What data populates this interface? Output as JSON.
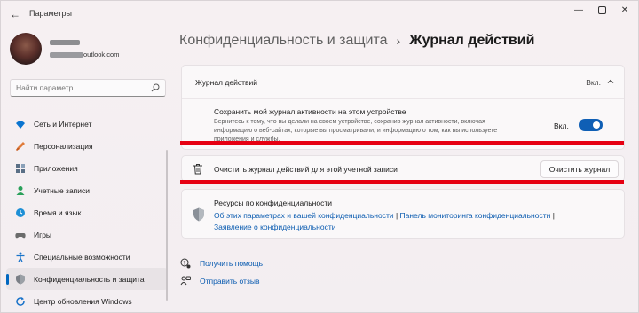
{
  "window": {
    "app_title": "Параметры",
    "back_icon": "back-arrow-icon",
    "minimize_icon": "minimize-icon",
    "maximize_icon": "maximize-icon",
    "close_icon": "close-icon"
  },
  "profile": {
    "email_visible": "outlook.com"
  },
  "search": {
    "placeholder": "Найти параметр",
    "icon": "search-icon"
  },
  "sidebar": {
    "items": [
      {
        "label": "Сеть и Интернет",
        "icon": "wifi-icon",
        "color": "#0a74d0"
      },
      {
        "label": "Персонализация",
        "icon": "brush-icon",
        "color": "#e07b39"
      },
      {
        "label": "Приложения",
        "icon": "apps-icon",
        "color": "#5a6f86"
      },
      {
        "label": "Учетные записи",
        "icon": "person-icon",
        "color": "#2aa05a"
      },
      {
        "label": "Время и язык",
        "icon": "globe-clock-icon",
        "color": "#1d8fd6"
      },
      {
        "label": "Игры",
        "icon": "gamepad-icon",
        "color": "#6b6b6b"
      },
      {
        "label": "Специальные возможности",
        "icon": "accessibility-icon",
        "color": "#1a73c9"
      },
      {
        "label": "Конфиденциальность и защита",
        "icon": "shield-icon",
        "color": "#7a7f86",
        "active": true
      },
      {
        "label": "Центр обновления Windows",
        "icon": "update-icon",
        "color": "#1a73c9"
      }
    ]
  },
  "header": {
    "parent": "Конфиденциальность и защита",
    "separator": "›",
    "current": "Журнал действий"
  },
  "history_card": {
    "title": "Журнал действий",
    "state": "Вкл.",
    "store_title": "Сохранить мой журнал активности на этом устройстве",
    "store_desc": "Вернитесь к тому, что вы делали на своем устройстве, сохранив журнал активности, включая информацию о веб-сайтах, которые вы просматривали, и информацию о том, как вы используете приложения и службы.",
    "toggle_label": "Вкл.",
    "toggle_on": true
  },
  "clear_card": {
    "label": "Очистить журнал действий для этой учетной записи",
    "button": "Очистить журнал"
  },
  "resources_card": {
    "title": "Ресурсы по конфиденциальности",
    "link1": "Об этих параметрах и вашей конфиденциальности",
    "sep": " | ",
    "link2": "Панель мониторинга конфиденциальности",
    "link3": "Заявление о конфиденциальности"
  },
  "help": {
    "get_help": "Получить помощь",
    "feedback": "Отправить отзыв"
  },
  "colors": {
    "accent": "#0f5fb5",
    "link": "#0a5bb0",
    "highlight": "#e60012"
  }
}
